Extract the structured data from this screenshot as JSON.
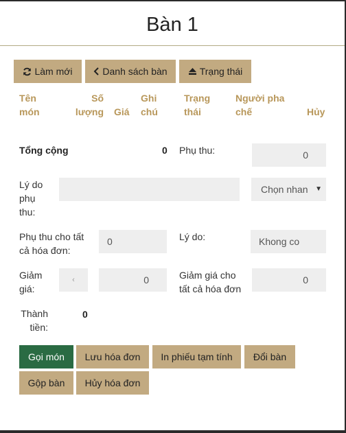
{
  "header": {
    "title": "Bàn 1"
  },
  "toolbar": {
    "refresh_label": "Làm mới",
    "table_list_label": "Danh sách bàn",
    "status_label": "Trạng thái"
  },
  "table": {
    "columns": [
      {
        "line1": "Tên",
        "line2": "món"
      },
      {
        "line1": "Số",
        "line2": "lượng"
      },
      {
        "line1": "",
        "line2": "Giá"
      },
      {
        "line1": "Ghi",
        "line2": "chú"
      },
      {
        "line1": "Trạng",
        "line2": "thái"
      },
      {
        "line1": "Người pha",
        "line2": "chế"
      },
      {
        "line1": "",
        "line2": "Hủy"
      }
    ]
  },
  "summary": {
    "total_label": "Tổng cộng",
    "total_value": "0",
    "surcharge_label": "Phụ thu:",
    "surcharge_value": "0",
    "surcharge_reason_label_1": "Lý do",
    "surcharge_reason_label_2": "phụ",
    "surcharge_reason_label_3": "thu:",
    "surcharge_reason_value": "",
    "select_value": "Chọn nhan",
    "surcharge_all_label_1": "Phụ thu cho tất",
    "surcharge_all_label_2": "cả hóa đơn:",
    "surcharge_all_value": "0",
    "reason_label": "Lý do:",
    "reason_value": "Khong co",
    "discount_label_1": "Giảm",
    "discount_label_2": "giá:",
    "discount_toggle": "‹",
    "discount_value": "0",
    "discount_all_label_1": "Giảm giá cho",
    "discount_all_label_2": "tất cả hóa đơn",
    "discount_all_value": "0",
    "grand_total_label_1": "Thành",
    "grand_total_label_2": "tiền:",
    "grand_total_value": "0"
  },
  "actions": {
    "order_label": "Gọi món",
    "save_label": "Lưu hóa đơn",
    "print_label": "In phiếu tạm tính",
    "change_table_label": "Đổi bàn",
    "merge_label": "Gộp bàn",
    "cancel_label": "Hủy hóa đơn"
  }
}
